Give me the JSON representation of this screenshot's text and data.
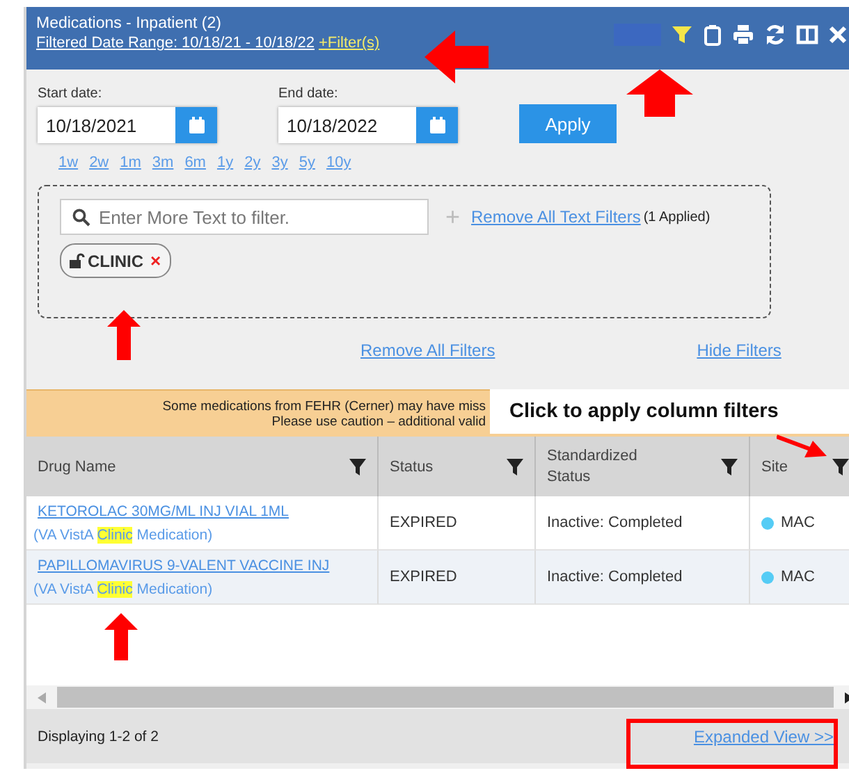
{
  "panel": {
    "title": "Medications - Inpatient (2)",
    "date_range_link": "Filtered Date Range: 10/18/21 - 10/18/22",
    "filters_link": "+Filter(s)"
  },
  "date_filter": {
    "start_label": "Start date:",
    "start_value": "10/18/2021",
    "end_label": "End date:",
    "end_value": "10/18/2022",
    "apply": "Apply",
    "quick_ranges": [
      "1w",
      "2w",
      "1m",
      "3m",
      "6m",
      "1y",
      "2y",
      "3y",
      "5y",
      "10y"
    ]
  },
  "text_filter": {
    "placeholder": "Enter More Text to filter.",
    "plus": "+",
    "remove_text_filters": "Remove All Text Filters",
    "applied_count": "(1 Applied)",
    "tags": [
      {
        "label": "CLINIC",
        "remove": "×"
      }
    ]
  },
  "remove_all_filters": "Remove All Filters",
  "hide_filters": "Hide Filters",
  "warning": [
    "Some medications from FEHR (Cerner) may have miss",
    "Please use caution – additional valid"
  ],
  "callout": "Click to apply column filters",
  "table": {
    "columns": [
      "Drug Name",
      "Status",
      "Standardized Status",
      "Site"
    ],
    "rows": [
      {
        "drug": "KETOROLAC 30MG/ML INJ VIAL 1ML",
        "source_before": "(VA VistA ",
        "source_highlight": "Clinic",
        "source_after": " Medication)",
        "status": "EXPIRED",
        "standardized_status": "Inactive: Completed",
        "site": "MAC",
        "color": "#55ccf5"
      },
      {
        "drug": "PAPILLOMAVIRUS 9-VALENT VACCINE INJ",
        "source_before": "(VA VistA ",
        "source_highlight": "Clinic",
        "source_after": " Medication)",
        "status": "EXPIRED",
        "standardized_status": "Inactive: Completed",
        "site": "MAC",
        "color": "#55ccf5"
      }
    ]
  },
  "footer": {
    "count": "Displaying 1-2 of 2",
    "expanded_view": "Expanded View >>"
  }
}
